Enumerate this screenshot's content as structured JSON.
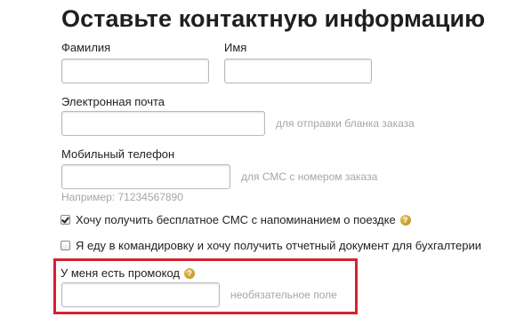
{
  "form": {
    "title": "Оставьте контактную информацию",
    "last_name": {
      "label": "Фамилия",
      "value": ""
    },
    "first_name": {
      "label": "Имя",
      "value": ""
    },
    "email": {
      "label": "Электронная почта",
      "value": "",
      "hint": "для отправки бланка заказа"
    },
    "mobile": {
      "label": "Мобильный телефон",
      "value": "",
      "hint": "для СМС с номером заказа",
      "example": "Например: 71234567890"
    },
    "sms_reminder": {
      "label": "Хочу получить бесплатное СМС с напоминанием о поездке",
      "checked": true,
      "help_icon": "question-icon"
    },
    "business_trip": {
      "label": "Я еду в командировку и хочу получить отчетный документ для бухгалтерии",
      "checked": false
    },
    "promo": {
      "label": "У меня есть промокод",
      "value": "",
      "hint": "необязательное поле",
      "help_icon": "question-icon"
    }
  },
  "colors": {
    "highlight_frame": "#d3232f",
    "hint_text": "#a6a6a6",
    "help_icon": "#c99a2e"
  }
}
